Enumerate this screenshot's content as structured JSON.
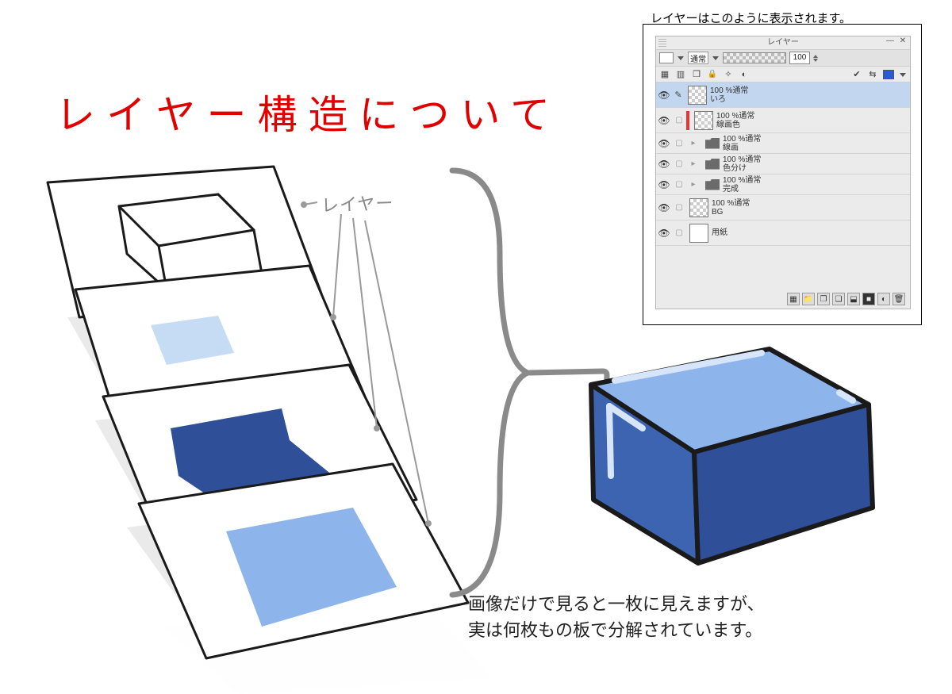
{
  "title": "レイヤー構造について",
  "handLabel": "レイヤー",
  "panelCaption": "レイヤーはこのように表示されます。",
  "bottomCaption": {
    "line1": "画像だけで見ると一枚に見えますが、",
    "line2": "実は何枚もの板で分解されています。"
  },
  "layerPanel": {
    "title": "レイヤー",
    "minimize": "—",
    "close": "✕",
    "blendMode": "通常",
    "opacity": "100",
    "toolbarIcons": [
      "layer-icon",
      "mask-icon",
      "link-icon",
      "lock-icon",
      "wand-icon",
      "ghost-icon",
      "check-icon",
      "transfer-icon",
      "color-icon",
      "dropdown-icon"
    ],
    "layers": [
      {
        "opacity": "100 %通常",
        "name": "いろ",
        "selected": true,
        "type": "raster",
        "editable": true,
        "thumb": "checker"
      },
      {
        "opacity": "100 %通常",
        "name": "線画色",
        "type": "raster",
        "thumb": "checker",
        "bar": true
      },
      {
        "opacity": "100 %通常",
        "name": "線画",
        "type": "folder"
      },
      {
        "opacity": "100 %通常",
        "name": "色分け",
        "type": "folder"
      },
      {
        "opacity": "100 %通常",
        "name": "完成",
        "type": "folder"
      },
      {
        "opacity": "100 %通常",
        "name": "BG",
        "type": "raster",
        "thumb": "checker"
      },
      {
        "opacity": "",
        "name": "用紙",
        "type": "raster",
        "thumb": "white"
      }
    ],
    "footerIcons": [
      "new-layer",
      "new-folder",
      "new-group",
      "duplicate-two",
      "merge",
      "mask-rect",
      "adjustment",
      "delete"
    ]
  },
  "colors": {
    "cubeLight": "#8eb4ec",
    "cubeDark": "#2f4f99",
    "cubeMid": "#3d64b1",
    "outline": "#1a1a1a",
    "arrow": "#8a8a8a"
  }
}
